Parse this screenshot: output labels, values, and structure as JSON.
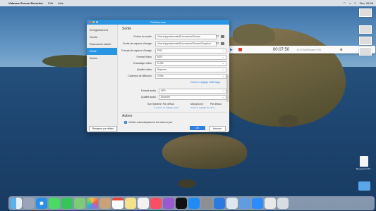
{
  "menubar": {
    "apple": "",
    "app_name": "Vidmore Screen Recorder",
    "items": [
      "Édit",
      "Aide"
    ],
    "clock": "Dim. 06:08"
  },
  "recorder": {
    "time": "00:07:50",
    "size": "10.33 Mo/Espace 9.00"
  },
  "desktop_files": [
    "",
    "",
    "",
    "",
    "Mouvement ST...",
    ""
  ],
  "window": {
    "title": "Préférences",
    "sidebar": {
      "items": [
        "Enregistrement",
        "Souris",
        "Raccourcis clavier",
        "Sortie",
        "Autres"
      ],
      "active": "Sortie",
      "reset_button": "Restaurer par défaut"
    },
    "output": {
      "section_title": "Sortie",
      "rows": [
        {
          "label": "Fichier de sortie",
          "value": "/Users/ipspeakermatsi/Documents/Vidmore",
          "more": "•••"
        },
        {
          "label": "Sortie de capture d'image",
          "value": "/Users/ipspeakermatsi/Documents/Vidmore/Snapshot",
          "more": "•••"
        },
        {
          "label": "Format de capture d'image",
          "value": "PNG"
        },
        {
          "label": "Format Vidéo",
          "value": "MOV"
        },
        {
          "label": "Encodage vidéo",
          "value": "H.264"
        },
        {
          "label": "Qualité vidéo",
          "value": "Moyenne"
        },
        {
          "label": "Cadence de diffusion",
          "value": "24 fps"
        }
      ],
      "video_link": "Ouvrir le réglage d'affichage",
      "audio_rows": [
        {
          "label": "Format audio",
          "value": "MP3"
        },
        {
          "label": "Qualité audio",
          "value": "Moyenne"
        }
      ],
      "system_sound_label": "Son Système :",
      "system_sound_value": "Par défaut",
      "mic_label": "Microphone :",
      "mic_value": "Par défaut",
      "sound_link": "À propos du réglage audio",
      "mic_link": "Ouvrir le réglage du micro"
    },
    "other": {
      "section_title": "Autres",
      "auto_update": "Vérifier automatiquement les mises à jour"
    },
    "buttons": {
      "ok": "OK",
      "cancel": "Annuler"
    }
  },
  "colors": {
    "accent": "#2996e4",
    "link": "#2f7de1",
    "record": "#e0382d"
  },
  "dock_icons": [
    "finder-icon",
    "launchpad-icon",
    "safari-icon",
    "messages-icon",
    "facetime-icon",
    "maps-icon",
    "photos-icon",
    "contacts-icon",
    "calendar-icon",
    "notes-icon",
    "reminders-icon",
    "music-icon",
    "podcasts-icon",
    "tv-icon",
    "appstore-icon",
    "settings-icon",
    "vidmore-icon",
    "preview-icon",
    "files-icon",
    "zoom-icon",
    "downloads-icon",
    "trash-icon"
  ]
}
